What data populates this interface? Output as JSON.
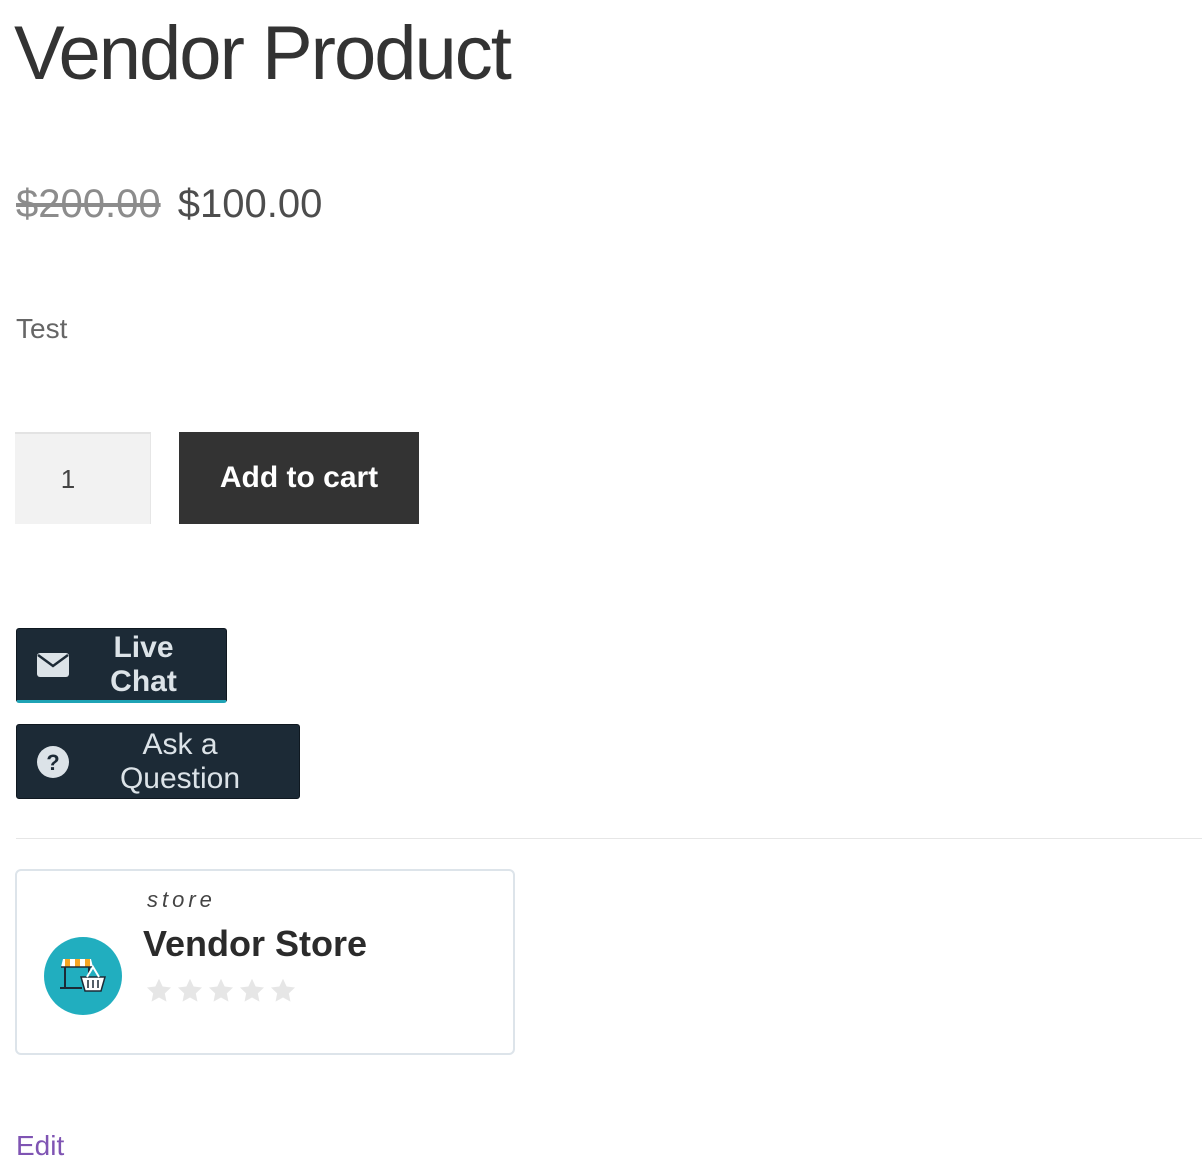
{
  "product": {
    "title": "Vendor Product",
    "regular_price": "$200.00",
    "sale_price": "$100.00",
    "description": "Test",
    "quantity": "1",
    "add_to_cart_label": "Add to cart"
  },
  "actions": {
    "live_chat_label": "Live Chat",
    "live_chat_icon": "envelope-icon",
    "ask_question_label": "Ask a Question",
    "ask_question_icon": "question-circle-icon"
  },
  "store": {
    "label": "store",
    "name": "Vendor Store",
    "rating_stars_total": 5,
    "rating_stars_filled": 0,
    "avatar_icon": "storefront-icon"
  },
  "edit_link": "Edit",
  "colors": {
    "add_to_cart_bg": "#333333",
    "action_button_bg": "#1c2a36",
    "action_button_accent": "#1fa3b5",
    "store_avatar_bg": "#21aebf",
    "edit_link": "#7f54b3",
    "star_empty": "#e6e6e6"
  }
}
